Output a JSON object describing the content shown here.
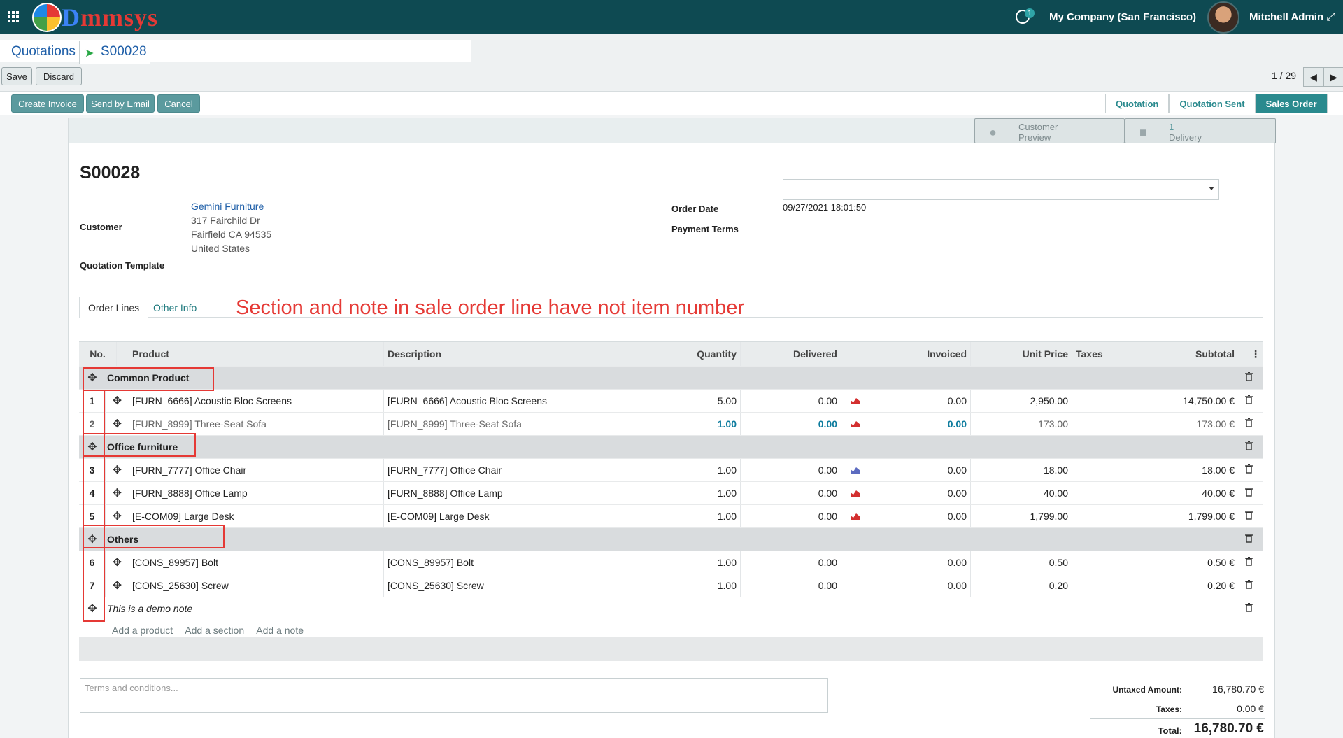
{
  "nav": {
    "logo": "Dmmsys",
    "logo_parts": [
      "D",
      "mmsys"
    ],
    "activity_count": "1",
    "company": "My Company (San Francisco)",
    "user": "Mitchell Admin"
  },
  "breadcrumb": {
    "parent": "Quotations",
    "current": "S00028"
  },
  "toolbar": {
    "save": "Save",
    "discard": "Discard",
    "pager": "1 / 29"
  },
  "actions": {
    "create_invoice": "Create Invoice",
    "send_email": "Send by Email",
    "cancel": "Cancel"
  },
  "statusbar": [
    "Quotation",
    "Quotation Sent",
    "Sales Order"
  ],
  "smart_buttons": {
    "preview_l1": "Customer",
    "preview_l2": "Preview",
    "delivery_count": "1",
    "delivery_label": "Delivery"
  },
  "order": {
    "name": "S00028",
    "customer_label": "Customer",
    "customer_name": "Gemini Furniture",
    "addr1": "317 Fairchild Dr",
    "addr2": "Fairfield CA 94535",
    "addr3": "United States",
    "template_label": "Quotation Template",
    "date_label": "Order Date",
    "date": "09/27/2021 18:01:50",
    "payment_terms_label": "Payment Terms"
  },
  "tabs": {
    "lines": "Order Lines",
    "other": "Other Info"
  },
  "annotation": "Section and note in sale order line have not item number",
  "columns": {
    "no": "No.",
    "product": "Product",
    "description": "Description",
    "quantity": "Quantity",
    "delivered": "Delivered",
    "invoiced": "Invoiced",
    "unit_price": "Unit Price",
    "taxes": "Taxes",
    "subtotal": "Subtotal"
  },
  "sections": {
    "s1": "Common Product",
    "s2": "Office furniture",
    "s3": "Others",
    "note": "This is  a demo note"
  },
  "lines": [
    {
      "no": "1",
      "product": "[FURN_6666] Acoustic Bloc Screens",
      "description": "[FURN_6666] Acoustic Bloc Screens",
      "qty": "5.00",
      "delivered": "0.00",
      "invoiced": "0.00",
      "price": "2,950.00",
      "subtotal": "14,750.00 €"
    },
    {
      "no": "2",
      "product": "[FURN_8999] Three-Seat Sofa",
      "description": "[FURN_8999] Three-Seat Sofa",
      "qty": "1.00",
      "delivered": "0.00",
      "invoiced": "0.00",
      "price": "173.00",
      "subtotal": "173.00 €"
    },
    {
      "no": "3",
      "product": "[FURN_7777] Office Chair",
      "description": "[FURN_7777] Office Chair",
      "qty": "1.00",
      "delivered": "0.00",
      "invoiced": "0.00",
      "price": "18.00",
      "subtotal": "18.00 €"
    },
    {
      "no": "4",
      "product": "[FURN_8888] Office Lamp",
      "description": "[FURN_8888] Office Lamp",
      "qty": "1.00",
      "delivered": "0.00",
      "invoiced": "0.00",
      "price": "40.00",
      "subtotal": "40.00 €"
    },
    {
      "no": "5",
      "product": "[E-COM09] Large Desk",
      "description": "[E-COM09] Large Desk",
      "qty": "1.00",
      "delivered": "0.00",
      "invoiced": "0.00",
      "price": "1,799.00",
      "subtotal": "1,799.00 €"
    },
    {
      "no": "6",
      "product": "[CONS_89957] Bolt",
      "description": "[CONS_89957] Bolt",
      "qty": "1.00",
      "delivered": "0.00",
      "invoiced": "0.00",
      "price": "0.50",
      "subtotal": "0.50 €"
    },
    {
      "no": "7",
      "product": "[CONS_25630] Screw",
      "description": "[CONS_25630] Screw",
      "qty": "1.00",
      "delivered": "0.00",
      "invoiced": "0.00",
      "price": "0.20",
      "subtotal": "0.20 €"
    }
  ],
  "add": {
    "product": "Add a product",
    "section": "Add a section",
    "note": "Add a note"
  },
  "terms_placeholder": "Terms and conditions...",
  "totals": {
    "untaxed_label": "Untaxed Amount:",
    "untaxed": "16,780.70 €",
    "taxes_label": "Taxes:",
    "taxes": "0.00 €",
    "total_label": "Total:",
    "total": "16,780.70 €"
  },
  "colors": {
    "navbar": "#0e4a52",
    "accent": "#2a8a8e",
    "annotation": "#e53935"
  },
  "icons": [
    "apps-icon",
    "activity-icon",
    "expand-icon",
    "arrow-icon",
    "chevron-left-icon",
    "chevron-right-icon",
    "globe-icon",
    "truck-icon",
    "move-handle-icon",
    "trash-icon",
    "forecast-chart-icon",
    "column-options-icon"
  ]
}
